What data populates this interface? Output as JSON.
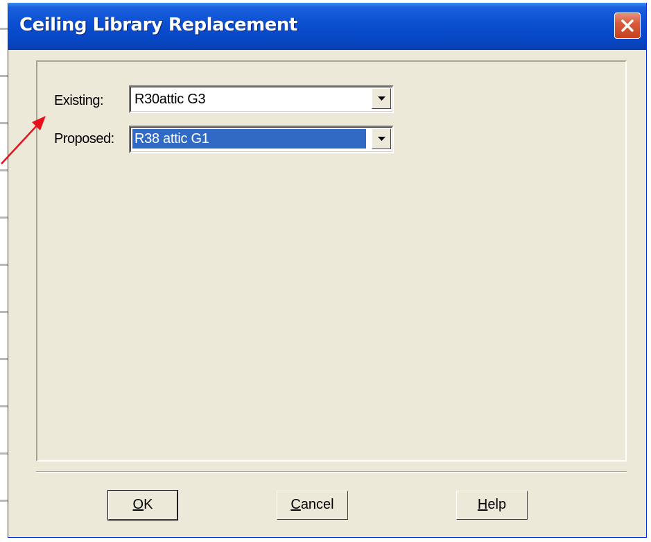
{
  "window": {
    "title": "Ceiling Library Replacement"
  },
  "form": {
    "existing": {
      "label": "Existing:",
      "value": "R30attic G3"
    },
    "proposed": {
      "label": "Proposed:",
      "value": "R38 attic G1"
    }
  },
  "buttons": {
    "ok": {
      "mnemonic": "O",
      "rest": "K"
    },
    "cancel": {
      "mnemonic": "C",
      "rest": "ancel"
    },
    "help": {
      "mnemonic": "H",
      "rest": "elp"
    }
  },
  "colors": {
    "titlebar": "#0a4fd0",
    "selection": "#316ac5",
    "annotation_arrow": "#e8101a",
    "dialog_bg": "#ece9d8"
  }
}
